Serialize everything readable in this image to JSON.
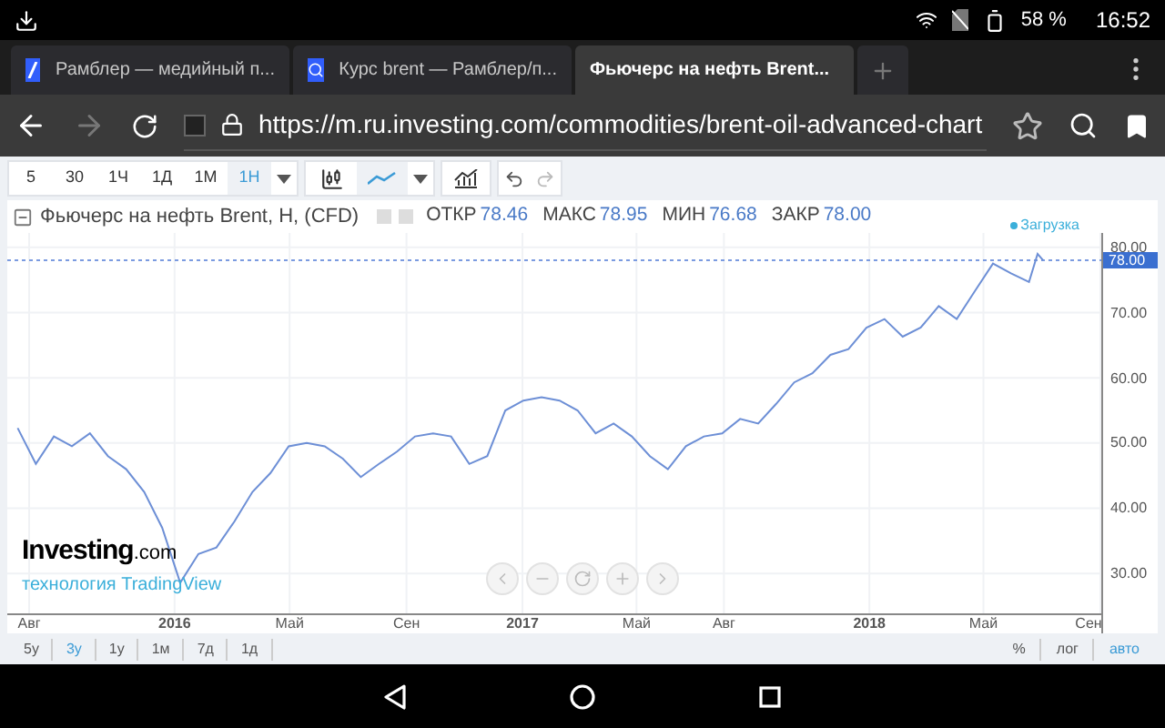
{
  "status_bar": {
    "battery": "58 %",
    "time": "16:52"
  },
  "browser_tabs": [
    {
      "title": "Рамблер — медийный п...",
      "kind": "slash",
      "selected": false
    },
    {
      "title": "Курс brent — Рамблер/п...",
      "kind": "search",
      "selected": false
    },
    {
      "title": "Фьючерс на нефть Brent...",
      "kind": "plain",
      "selected": true
    }
  ],
  "address_bar": {
    "url": "https://m.ru.investing.com/commodities/brent-oil-advanced-chart"
  },
  "toolbar": {
    "intervals": [
      {
        "label": "5",
        "selected": false
      },
      {
        "label": "30",
        "selected": false
      },
      {
        "label": "1Ч",
        "selected": false
      },
      {
        "label": "1Д",
        "selected": false
      },
      {
        "label": "1М",
        "selected": false
      },
      {
        "label": "1Н",
        "selected": true
      }
    ],
    "chart_styles": [
      {
        "kind": "candles",
        "selected": false
      },
      {
        "kind": "line",
        "selected": true
      }
    ],
    "history": [
      {
        "kind": "undo",
        "disabled": false
      },
      {
        "kind": "redo",
        "disabled": true
      }
    ]
  },
  "chart": {
    "title": "Фьючерс на нефть Brent, H, (CFD)",
    "stats": [
      {
        "label": "ОТКР",
        "value": "78.46"
      },
      {
        "label": "МАКС",
        "value": "78.95"
      },
      {
        "label": "МИН",
        "value": "76.68"
      },
      {
        "label": "ЗАКР",
        "value": "78.00"
      }
    ],
    "status": "Загрузка",
    "logo": {
      "name": "Investing",
      "suffix": ".com",
      "tagline": "технология TradingView"
    },
    "chart_data": {
      "type": "line",
      "x": [
        "2015-07-20",
        "2015-08-08",
        "2015-08-27",
        "2015-09-15",
        "2015-10-04",
        "2015-10-23",
        "2015-11-11",
        "2015-11-30",
        "2015-12-19",
        "2016-01-07",
        "2016-01-26",
        "2016-02-14",
        "2016-03-04",
        "2016-03-23",
        "2016-04-11",
        "2016-04-30",
        "2016-05-19",
        "2016-06-07",
        "2016-06-26",
        "2016-07-15",
        "2016-08-03",
        "2016-08-22",
        "2016-09-10",
        "2016-09-29",
        "2016-10-18",
        "2016-11-06",
        "2016-11-25",
        "2016-12-14",
        "2017-01-02",
        "2017-01-21",
        "2017-02-09",
        "2017-02-28",
        "2017-03-19",
        "2017-04-07",
        "2017-04-26",
        "2017-05-15",
        "2017-06-03",
        "2017-06-22",
        "2017-07-11",
        "2017-07-30",
        "2017-08-18",
        "2017-09-06",
        "2017-09-25",
        "2017-10-14",
        "2017-11-02",
        "2017-11-21",
        "2017-12-10",
        "2017-12-29",
        "2018-01-17",
        "2018-02-05",
        "2018-02-24",
        "2018-03-15",
        "2018-04-03",
        "2018-04-22",
        "2018-05-11",
        "2018-05-30",
        "2018-06-18",
        "2018-06-27",
        "2018-07-03"
      ],
      "series": [
        {
          "color": "#6d8fd6",
          "values": [
            52.3,
            46.8,
            51,
            49.5,
            51.5,
            48,
            46,
            42.5,
            37,
            28.6,
            33,
            34,
            38,
            42.5,
            45.4,
            49.5,
            50,
            49.5,
            47.6,
            44.8,
            46.8,
            48.7,
            51,
            51.5,
            51,
            46.8,
            48,
            55,
            56.5,
            57,
            56.5,
            55,
            51.5,
            53,
            51,
            48,
            46,
            49.5,
            51,
            51.5,
            53.7,
            53,
            56,
            59.3,
            60.7,
            63.5,
            64.4,
            67.7,
            69,
            66.3,
            67.7,
            71,
            69,
            73.3,
            77.5,
            76,
            74.7,
            79,
            78
          ]
        }
      ],
      "xlim": [
        "2015-07-09",
        "2018-09-02"
      ],
      "ylim": [
        23.9,
        82.2
      ],
      "xticks": [
        {
          "value": "2015-08-01",
          "label": "Авг"
        },
        {
          "value": "2016-01-01",
          "label": "2016"
        },
        {
          "value": "2016-05-01",
          "label": "Май"
        },
        {
          "value": "2016-09-01",
          "label": "Сен"
        },
        {
          "value": "2017-01-01",
          "label": "2017"
        },
        {
          "value": "2017-05-01",
          "label": "Май"
        },
        {
          "value": "2017-08-01",
          "label": "Авг"
        },
        {
          "value": "2018-01-01",
          "label": "2018"
        },
        {
          "value": "2018-05-01",
          "label": "Май"
        },
        {
          "value": "2018-09-01",
          "label": "Сен"
        }
      ],
      "yticks": [
        {
          "value": 30,
          "label": "30.00"
        },
        {
          "value": 40,
          "label": "40.00"
        },
        {
          "value": 50,
          "label": "50.00"
        },
        {
          "value": 60,
          "label": "60.00"
        },
        {
          "value": 70,
          "label": "70.00"
        },
        {
          "value": 80,
          "label": "80.00"
        }
      ],
      "grid": true,
      "ref_lines": [
        {
          "axis": "y",
          "value": 78,
          "label": "78.00"
        }
      ]
    }
  },
  "ranges": [
    {
      "label": "5у",
      "selected": false
    },
    {
      "label": "3у",
      "selected": true
    },
    {
      "label": "1у",
      "selected": false
    },
    {
      "label": "1м",
      "selected": false
    },
    {
      "label": "7д",
      "selected": false
    },
    {
      "label": "1д",
      "selected": false
    }
  ],
  "scale_options": [
    {
      "label": "%",
      "selected": false
    },
    {
      "label": "лог",
      "selected": false
    },
    {
      "label": "авто",
      "selected": true
    }
  ]
}
